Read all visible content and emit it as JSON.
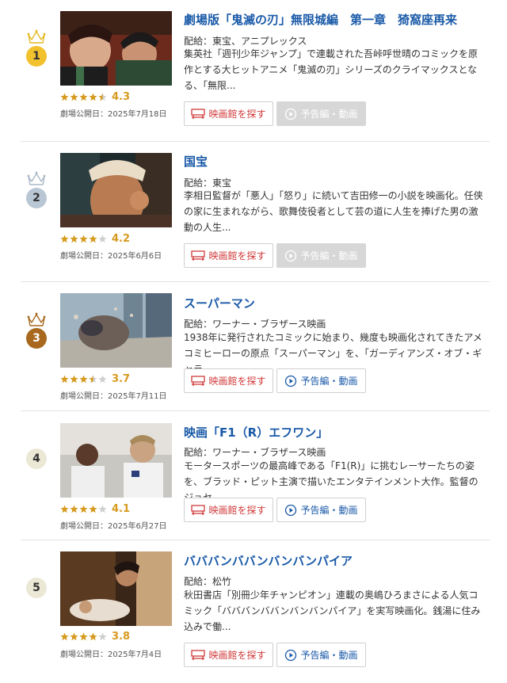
{
  "labels": {
    "theater_button": "映画館を探す",
    "trailer_button": "予告編・動画"
  },
  "colors": {
    "title": "#1a5aa8",
    "rating": "#d69a1e",
    "gold": "#f2c12e",
    "silver": "#b9c6d3",
    "bronze": "#a8691f",
    "plain_rank": "#ece8d6"
  },
  "movies": [
    {
      "rank": "1",
      "title": "劇場版「鬼滅の刃」無限城編　第一章　猗窩座再来",
      "distributor": "配給：東宝、アニプレックス",
      "synopsis": "集英社「週刊少年ジャンプ」で連載された吾峠呼世晴のコミックを原作とする大ヒットアニメ「鬼滅の刃」シリーズのクライマックスとなる、「無限...",
      "rating": "4.3",
      "release": "劇場公開日：2025年7月18日",
      "trailer_available": false
    },
    {
      "rank": "2",
      "title": "国宝",
      "distributor": "配給：東宝",
      "synopsis": "李相日監督が「悪人」「怒り」に続いて吉田修一の小説を映画化。任侠の家に生まれながら、歌舞伎役者として芸の道に人生を捧げた男の激動の人生...",
      "rating": "4.2",
      "release": "劇場公開日：2025年6月6日",
      "trailer_available": false
    },
    {
      "rank": "3",
      "title": "スーパーマン",
      "distributor": "配給：ワーナー・ブラザース映画",
      "synopsis": "1938年に発行されたコミックに始まり、幾度も映画化されてきたアメコミヒーローの原点「スーパーマン」を、「ガーディアンズ・オブ・ギャラ...",
      "rating": "3.7",
      "release": "劇場公開日：2025年7月11日",
      "trailer_available": true
    },
    {
      "rank": "4",
      "title": "映画「F1（R）エフワン」",
      "distributor": "配給：ワーナー・ブラザース映画",
      "synopsis": "モータースポーツの最高峰である「F1(R)」に挑むレーサーたちの姿を、ブラッド・ピット主演で描いたエンタテインメント大作。監督のジョセ...",
      "rating": "4.1",
      "release": "劇場公開日：2025年6月27日",
      "trailer_available": true
    },
    {
      "rank": "5",
      "title": "バババンババンバンバンパイア",
      "distributor": "配給：松竹",
      "synopsis": "秋田書店「別冊少年チャンピオン」連載の奥嶋ひろまさによる人気コミック「バババンババンバンバンパイア」を実写映画化。銭湯に住み込みで働...",
      "rating": "3.8",
      "release": "劇場公開日：2025年7月4日",
      "trailer_available": true
    }
  ]
}
